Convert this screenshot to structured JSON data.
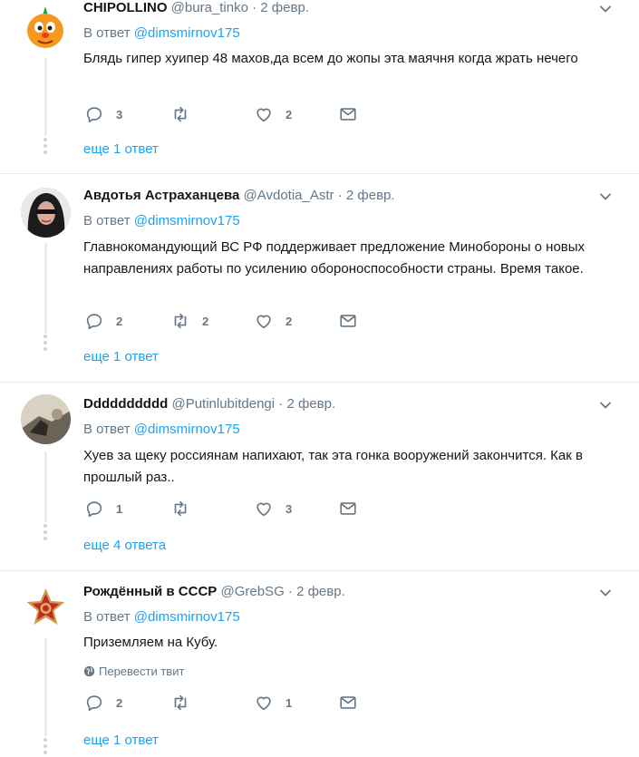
{
  "reply_prefix": "В ответ",
  "translate_label": "Перевести твит",
  "tweets": [
    {
      "name": "CHIPOLLINO",
      "handle": "@bura_tinko",
      "date": "2 февр.",
      "reply_to": "@dimsmirnov175",
      "text": "Блядь гипер хуипер 48 махов,да всем до жопы эта маячня когда жрать нечего",
      "replies": "3",
      "retweets": "",
      "likes": "2",
      "more_replies": "еще 1 ответ"
    },
    {
      "name": "Авдотья Астраханцева",
      "handle": "@Avdotia_Astr",
      "date": "2 февр.",
      "reply_to": "@dimsmirnov175",
      "text": "Главнокомандующий ВС РФ поддерживает предложение Минобороны о новых направлениях работы по усилению обороноспособности страны. Время такое.",
      "replies": "2",
      "retweets": "2",
      "likes": "2",
      "more_replies": "еще 1 ответ"
    },
    {
      "name": "Dddddddddd",
      "handle": "@Putinlubitdengi",
      "date": "2 февр.",
      "reply_to": "@dimsmirnov175",
      "text": "Хуев за щеку россиянам напихают, так эта гонка вооружений закончится. Как в прошлый раз..",
      "replies": "1",
      "retweets": "",
      "likes": "3",
      "more_replies": "еще 4 ответа"
    },
    {
      "name": "Рождённый в СССР",
      "handle": "@GrebSG",
      "date": "2 февр.",
      "reply_to": "@dimsmirnov175",
      "text": "Приземляем на Кубу.",
      "replies": "2",
      "retweets": "",
      "likes": "1",
      "more_replies": "еще 1 ответ"
    }
  ]
}
